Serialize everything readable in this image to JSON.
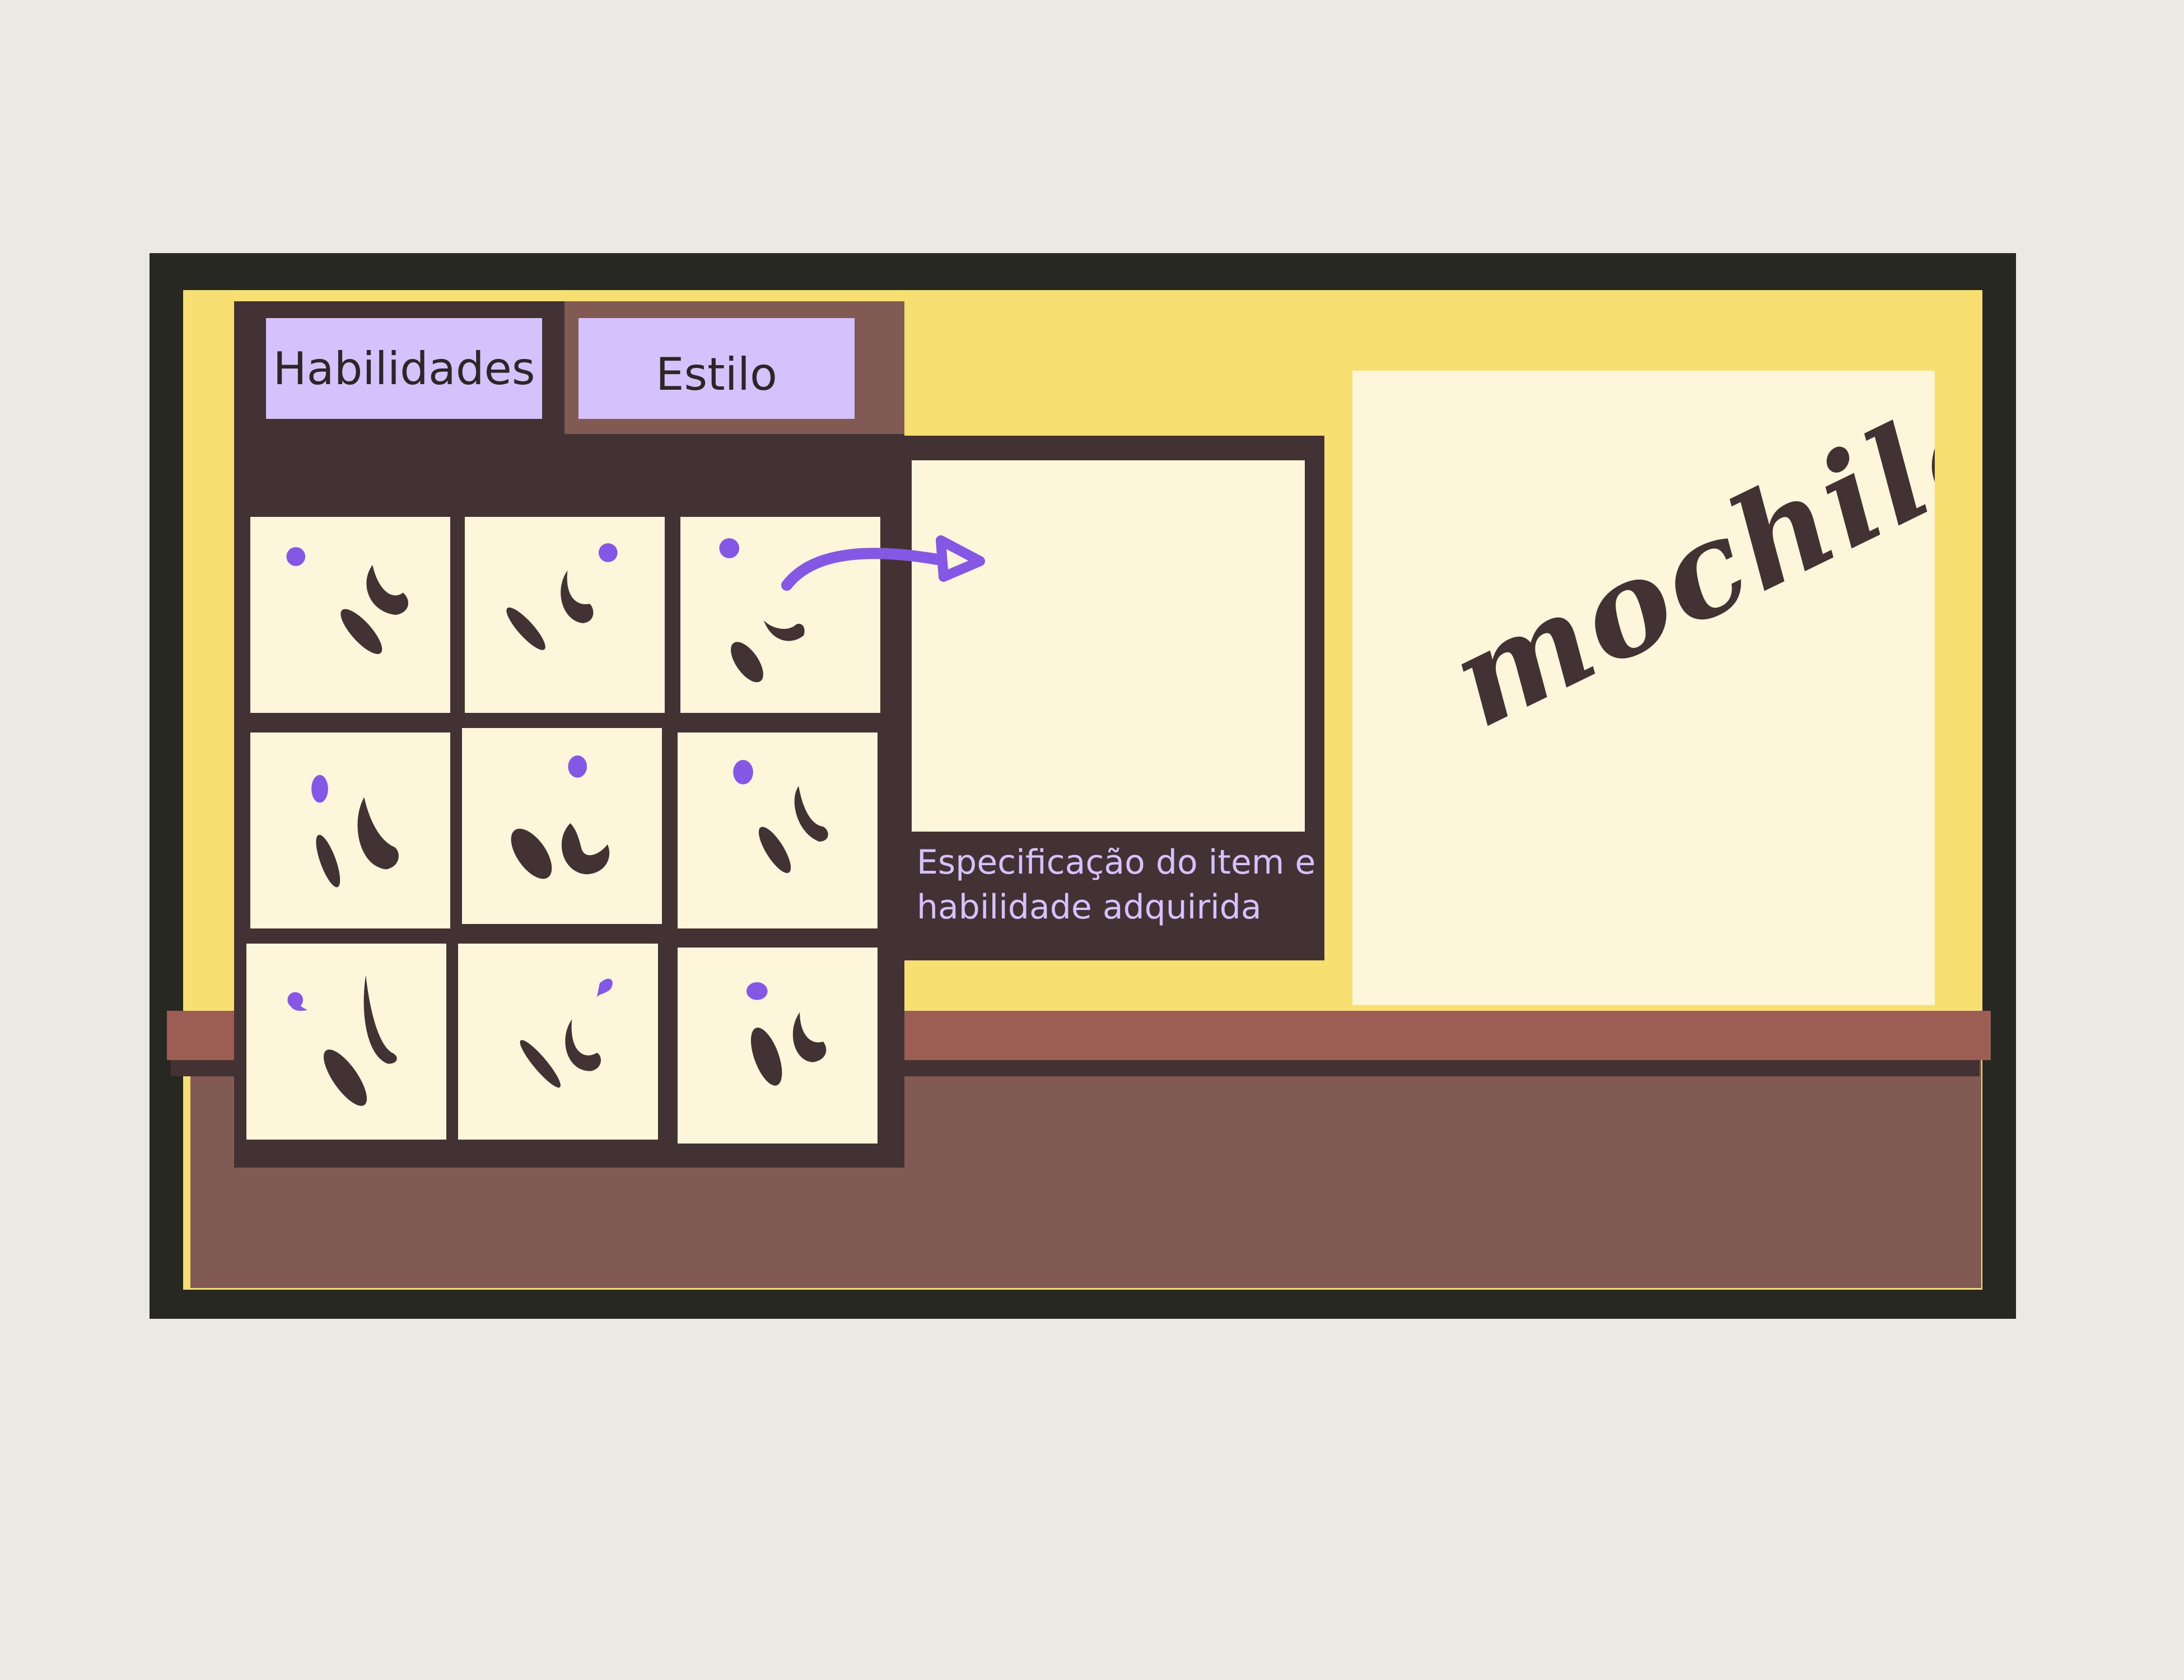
{
  "inventory": {
    "tabs": [
      {
        "label": "Habilidades"
      },
      {
        "label": "Estilo"
      }
    ],
    "slot_count": 9,
    "detail_caption": "Especificação do item e habilidade adquirida"
  },
  "backpack": {
    "title": "mochila"
  },
  "colors": {
    "background": "#EBE9E3",
    "frame": "#282823",
    "wall": "#F7E071",
    "panel_dark": "#433234",
    "panel_brown": "#825A54",
    "shelf": "#9C5E54",
    "slot": "#FDF6DA",
    "tab": "#D5C2FC",
    "accent_purple": "#8557E5"
  }
}
